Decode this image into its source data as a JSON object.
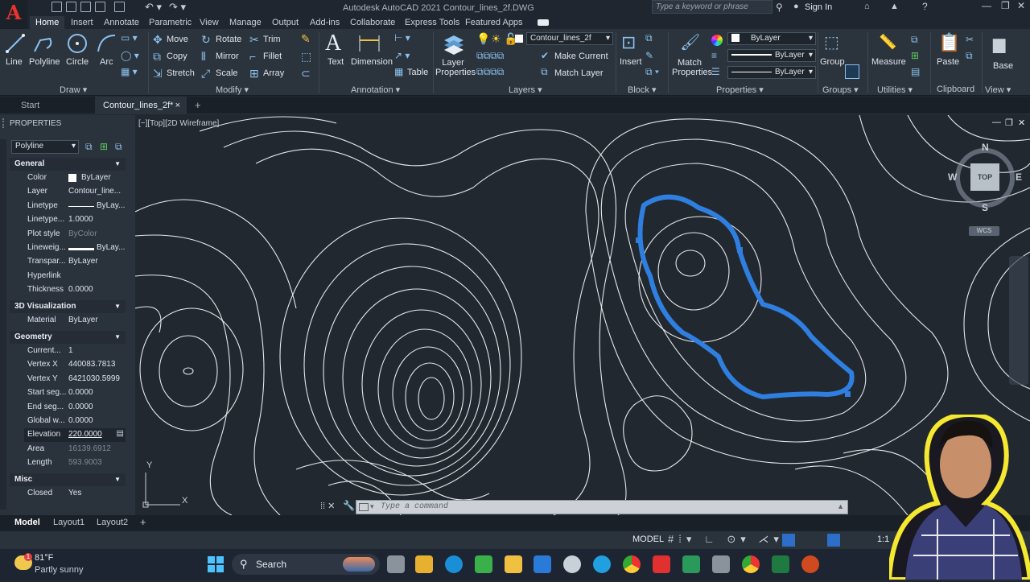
{
  "app": {
    "title": "Autodesk AutoCAD 2021    Contour_lines_2f.DWG",
    "search_placeholder": "Type a keyword or phrase",
    "sign_in": "Sign In",
    "logo_letter": "A"
  },
  "ribbon_tabs": [
    "Home",
    "Insert",
    "Annotate",
    "Parametric",
    "View",
    "Manage",
    "Output",
    "Add-ins",
    "Collaborate",
    "Express Tools",
    "Featured Apps"
  ],
  "ribbon": {
    "draw": {
      "line": "Line",
      "polyline": "Polyline",
      "circle": "Circle",
      "arc": "Arc",
      "panel": "Draw"
    },
    "modify": {
      "move": "Move",
      "rotate": "Rotate",
      "trim": "Trim",
      "copy": "Copy",
      "mirror": "Mirror",
      "fillet": "Fillet",
      "stretch": "Stretch",
      "scale": "Scale",
      "array": "Array",
      "panel": "Modify"
    },
    "annotation": {
      "text": "Text",
      "dimension": "Dimension",
      "table": "Table",
      "panel": "Annotation"
    },
    "layers": {
      "layer_properties": "Layer Properties",
      "current_layer": "Contour_lines_2f",
      "make_current": "Make Current",
      "match_layer": "Match Layer",
      "panel": "Layers"
    },
    "block": {
      "insert": "Insert",
      "panel": "Block"
    },
    "properties": {
      "match": "Match Properties",
      "color": "ByLayer",
      "linetype": "ByLayer",
      "lineweight": "ByLayer",
      "panel": "Properties"
    },
    "groups": {
      "group": "Group",
      "panel": "Groups"
    },
    "utilities": {
      "measure": "Measure",
      "panel": "Utilities"
    },
    "clipboard": {
      "paste": "Paste",
      "panel": "Clipboard"
    },
    "view": {
      "base": "Base",
      "panel": "View"
    }
  },
  "doc_tabs": {
    "start": "Start",
    "drawing": "Contour_lines_2f*",
    "close": "×",
    "new": "+"
  },
  "properties_panel": {
    "title": "PROPERTIES",
    "object_type": "Polyline",
    "sections": {
      "general": {
        "title": "General",
        "rows": [
          {
            "k": "Color",
            "v": "ByLayer"
          },
          {
            "k": "Layer",
            "v": "Contour_line..."
          },
          {
            "k": "Linetype",
            "v": "ByLay..."
          },
          {
            "k": "Linetype...",
            "v": "1.0000"
          },
          {
            "k": "Plot style",
            "v": "ByColor"
          },
          {
            "k": "Lineweig...",
            "v": "ByLay..."
          },
          {
            "k": "Transpar...",
            "v": "ByLayer"
          },
          {
            "k": "Hyperlink",
            "v": ""
          },
          {
            "k": "Thickness",
            "v": "0.0000"
          }
        ]
      },
      "viz": {
        "title": "3D Visualization",
        "rows": [
          {
            "k": "Material",
            "v": "ByLayer"
          }
        ]
      },
      "geometry": {
        "title": "Geometry",
        "rows": [
          {
            "k": "Current...",
            "v": "1"
          },
          {
            "k": "Vertex X",
            "v": "440083.7813"
          },
          {
            "k": "Vertex Y",
            "v": "6421030.5999"
          },
          {
            "k": "Start seg...",
            "v": "0.0000"
          },
          {
            "k": "End seg...",
            "v": "0.0000"
          },
          {
            "k": "Global w...",
            "v": "0.0000"
          },
          {
            "k": "Elevation",
            "v": "220.0000"
          },
          {
            "k": "Area",
            "v": "16139.6912"
          },
          {
            "k": "Length",
            "v": "593.9003"
          }
        ]
      },
      "misc": {
        "title": "Misc",
        "rows": [
          {
            "k": "Closed",
            "v": "Yes"
          }
        ]
      }
    }
  },
  "viewport": {
    "label": "[−][Top][2D Wireframe]",
    "cube": {
      "n": "N",
      "s": "S",
      "e": "E",
      "w": "W",
      "top": "TOP",
      "wcs": "WCS"
    },
    "ucs": {
      "x": "X",
      "y": "Y"
    }
  },
  "command": {
    "placeholder": "Type a command"
  },
  "layout_tabs": [
    "Model",
    "Layout1",
    "Layout2"
  ],
  "status": {
    "model": "MODEL",
    "scale": "1:1"
  },
  "taskbar": {
    "temp": "81°F",
    "weather": "Partly sunny",
    "search": "Search",
    "badge": "1"
  },
  "colors": {
    "selection": "#2f7fe0",
    "accent": "#0a64c8",
    "contour": "#e6e8ea",
    "frame": "#f5e830"
  }
}
